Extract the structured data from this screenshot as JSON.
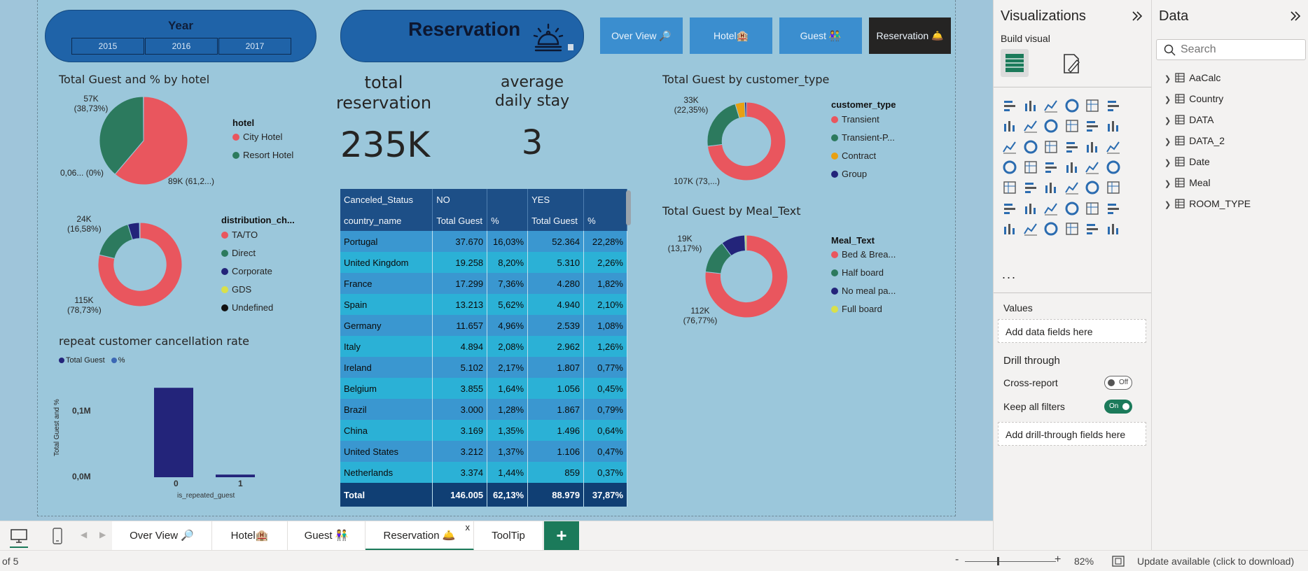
{
  "slicer": {
    "title": "Year",
    "years": [
      "2015",
      "2016",
      "2017"
    ]
  },
  "page_title": "Reservation",
  "nav": [
    "Over View 🔎",
    "Hotel🏨",
    "Guest 👫",
    "Reservation 🛎️"
  ],
  "kpi": {
    "total_label": [
      "total",
      "reservation"
    ],
    "total_value": "235K",
    "avg_label": [
      "average",
      "daily stay"
    ],
    "avg_value": "3"
  },
  "colors": {
    "red": "#e9565e",
    "teal": "#2c7a5e",
    "navy": "#23247a",
    "orange": "#e8a012",
    "yellow": "#d9e04a",
    "black": "#111111",
    "accent_dark": "#252423"
  },
  "charts": {
    "hotel": {
      "title": "Total Guest and % by hotel",
      "legend_title": "hotel",
      "legend": [
        "City Hotel",
        "Resort Hotel"
      ],
      "labels": [
        "57K\n(38,73%)",
        "0,06... (0%)",
        "89K (61,2...)"
      ]
    },
    "distribution": {
      "legend_title": "distribution_ch...",
      "legend": [
        "TA/TO",
        "Direct",
        "Corporate",
        "GDS",
        "Undefined"
      ],
      "labels": [
        "24K\n(16,58%)",
        "115K\n(78,73%)"
      ]
    },
    "repeat": {
      "title": "repeat customer cancellation rate",
      "legend": [
        "Total Guest",
        "%"
      ],
      "ylabel": "Total Guest and %",
      "xlabel": "is_repeated_guest",
      "yticks": [
        "0,1M",
        "0,0M"
      ],
      "xticks": [
        "0",
        "1"
      ]
    },
    "customer_type": {
      "title": "Total Guest by customer_type",
      "legend_title": "customer_type",
      "legend": [
        "Transient",
        "Transient-P...",
        "Contract",
        "Group"
      ],
      "labels": [
        "33K\n(22,35%)",
        "107K (73,...)"
      ]
    },
    "meal": {
      "title": "Total Guest by Meal_Text",
      "legend_title": "Meal_Text",
      "legend": [
        "Bed & Brea...",
        "Half board",
        "No meal pa...",
        "Full board"
      ],
      "labels": [
        "19K\n(13,17%)",
        "112K\n(76,77%)"
      ]
    }
  },
  "chart_data": [
    {
      "type": "pie",
      "categories": [
        "City Hotel",
        "Resort Hotel",
        "(0%)"
      ],
      "values": [
        61.2,
        38.73,
        0.06
      ]
    },
    {
      "type": "pie",
      "categories": [
        "TA/TO",
        "Direct",
        "Corporate",
        "GDS",
        "Undefined"
      ],
      "values": [
        78.73,
        16.58,
        4.5,
        0.2,
        0.01
      ]
    },
    {
      "type": "bar",
      "categories": [
        "0",
        "1"
      ],
      "series": [
        {
          "name": "Total Guest",
          "values": [
            0.135,
            0.004
          ]
        }
      ],
      "ylim": [
        0,
        0.15
      ]
    },
    {
      "type": "pie",
      "categories": [
        "Transient",
        "Transient-P...",
        "Contract",
        "Group"
      ],
      "values": [
        73,
        22.35,
        3.9,
        0.75
      ]
    },
    {
      "type": "pie",
      "categories": [
        "Bed & Brea...",
        "Half board",
        "No meal pa...",
        "Full board"
      ],
      "values": [
        76.77,
        13.17,
        9.4,
        0.66
      ]
    }
  ],
  "table": {
    "header1": [
      "Canceled_Status",
      "NO",
      "",
      "YES",
      ""
    ],
    "header2": [
      "country_name",
      "Total Guest",
      "%",
      "Total Guest",
      "%"
    ],
    "rows": [
      [
        "Portugal",
        "37.670",
        "16,03%",
        "52.364",
        "22,28%"
      ],
      [
        "United Kingdom",
        "19.258",
        "8,20%",
        "5.310",
        "2,26%"
      ],
      [
        "France",
        "17.299",
        "7,36%",
        "4.280",
        "1,82%"
      ],
      [
        "Spain",
        "13.213",
        "5,62%",
        "4.940",
        "2,10%"
      ],
      [
        "Germany",
        "11.657",
        "4,96%",
        "2.539",
        "1,08%"
      ],
      [
        "Italy",
        "4.894",
        "2,08%",
        "2.962",
        "1,26%"
      ],
      [
        "Ireland",
        "5.102",
        "2,17%",
        "1.807",
        "0,77%"
      ],
      [
        "Belgium",
        "3.855",
        "1,64%",
        "1.056",
        "0,45%"
      ],
      [
        "Brazil",
        "3.000",
        "1,28%",
        "1.867",
        "0,79%"
      ],
      [
        "China",
        "3.169",
        "1,35%",
        "1.496",
        "0,64%"
      ],
      [
        "United States",
        "3.212",
        "1,37%",
        "1.106",
        "0,47%"
      ],
      [
        "Netherlands",
        "3.374",
        "1,44%",
        "859",
        "0,37%"
      ]
    ],
    "total": [
      "Total",
      "146.005",
      "62,13%",
      "88.979",
      "37,87%"
    ]
  },
  "viz_pane": {
    "title": "Visualizations",
    "build_visual": "Build visual",
    "values_label": "Values",
    "values_well": "Add data fields here",
    "drill_title": "Drill through",
    "cross_report": "Cross-report",
    "cross_state": "Off",
    "keep_filters": "Keep all filters",
    "keep_state": "On",
    "drill_well": "Add drill-through fields here",
    "more": "..."
  },
  "data_pane": {
    "title": "Data",
    "search_placeholder": "Search",
    "fields": [
      "AaCalc",
      "Country",
      "DATA",
      "DATA_2",
      "Date",
      "Meal",
      "ROOM_TYPE"
    ]
  },
  "tabs": [
    "Over View 🔎",
    "Hotel🏨",
    "Guest 👫",
    "Reservation 🛎️",
    "ToolTip"
  ],
  "add_tab": "+",
  "close_tab": "x",
  "status": {
    "page": "of 5",
    "zoom_minus": "-",
    "zoom_plus": "+",
    "zoom": "82%",
    "update": "Update available (click to download)"
  }
}
